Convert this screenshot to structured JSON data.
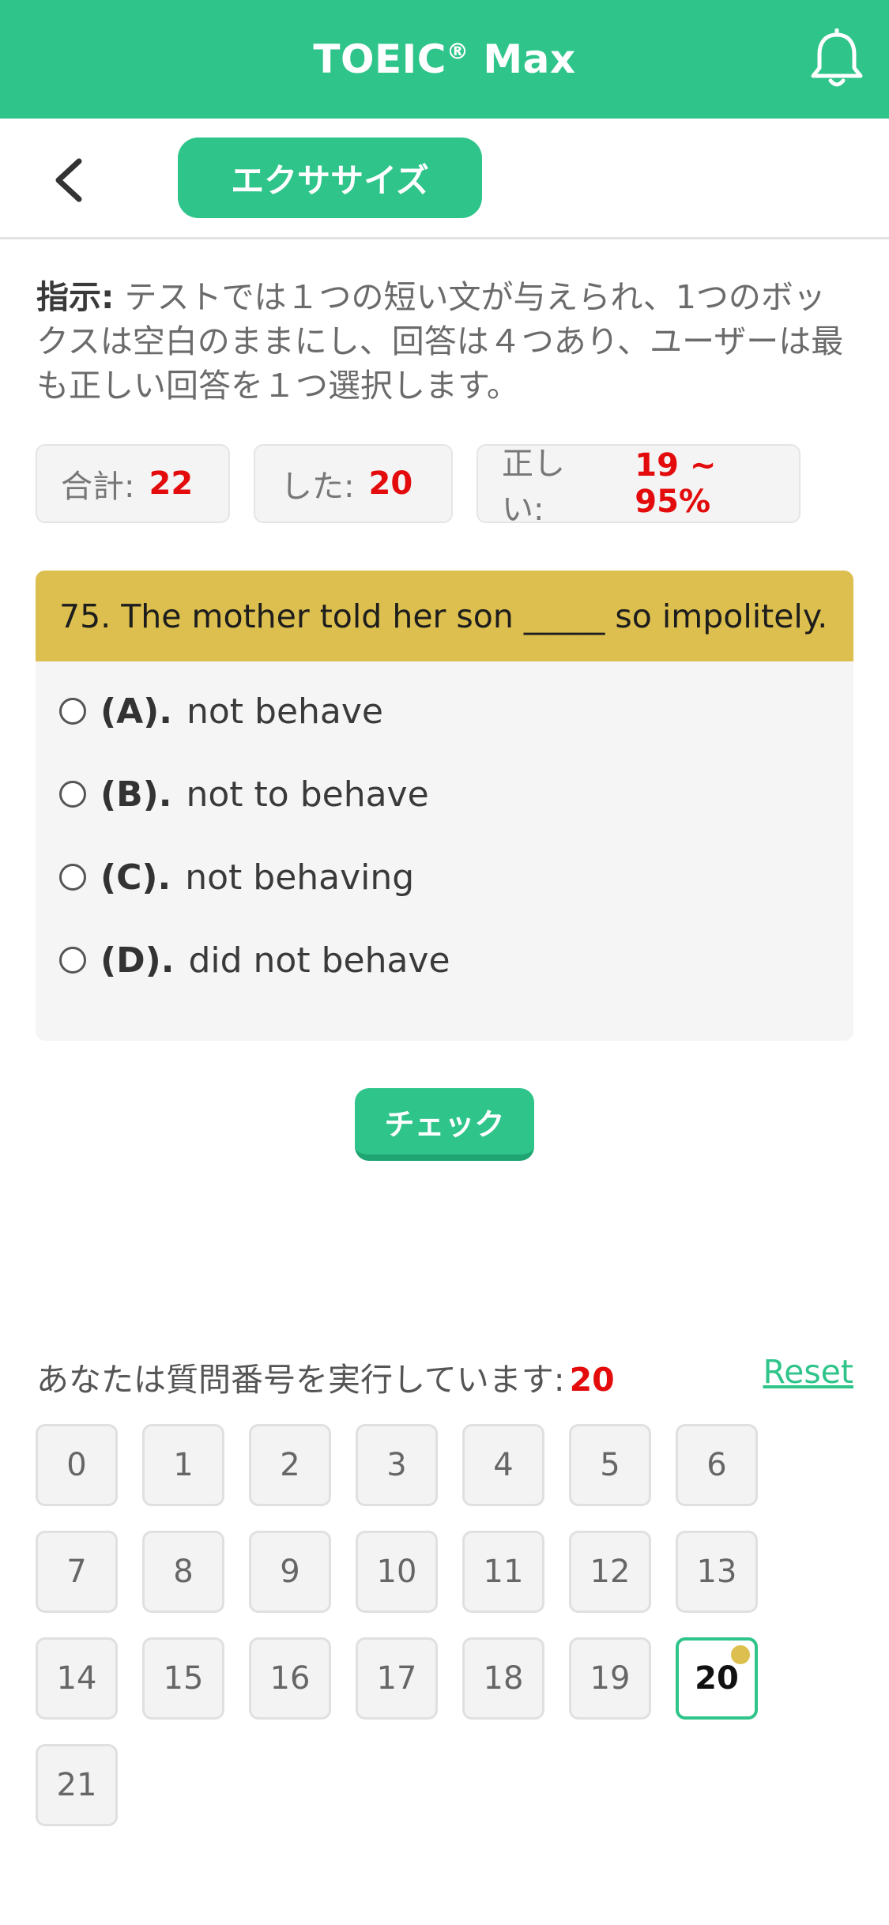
{
  "app": {
    "title": "TOEIC",
    "title_mark": "®",
    "title_suffix": " Max"
  },
  "nav": {
    "section_label": "エクササイズ"
  },
  "instructions": {
    "label": "指示:",
    "text": " テストでは１つの短い文が与えられ、1つのボックスは空白のままにし、回答は４つあり、ユーザーは最も正しい回答を１つ選択します。"
  },
  "stats": {
    "total_label": "合計:",
    "total_value": "22",
    "done_label": "した:",
    "done_value": "20",
    "correct_label": "正しい:",
    "correct_value": "19 ~ 95%"
  },
  "question": {
    "text": "75. The mother told her son _____ so impolitely.",
    "options": [
      {
        "letter": "(A).",
        "text": "not behave"
      },
      {
        "letter": "(B).",
        "text": "not to behave"
      },
      {
        "letter": "(C).",
        "text": "not behaving"
      },
      {
        "letter": "(D).",
        "text": "did not behave"
      }
    ]
  },
  "check_label": "チェック",
  "progress": {
    "running_label": "あなたは質問番号を実行しています:",
    "current": "20",
    "reset_label": "Reset",
    "numbers": [
      "0",
      "1",
      "2",
      "3",
      "4",
      "5",
      "6",
      "7",
      "8",
      "9",
      "10",
      "11",
      "12",
      "13",
      "14",
      "15",
      "16",
      "17",
      "18",
      "19",
      "20",
      "21"
    ]
  },
  "colors": {
    "brand": "#2ec48a",
    "question_bar": "#dcbf4e",
    "accent_red": "#e30b0b"
  },
  "icons": {
    "bell": "bell-icon",
    "back": "chevron-left-icon"
  }
}
